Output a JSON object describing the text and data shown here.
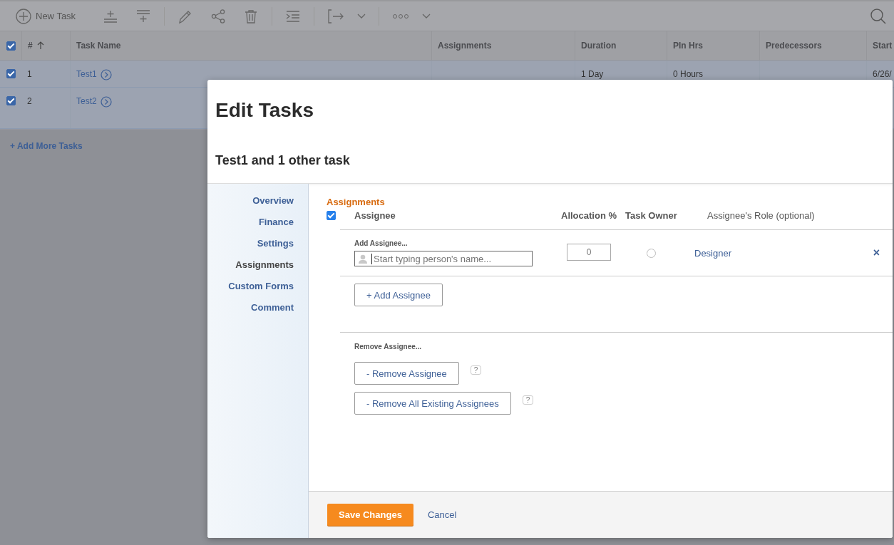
{
  "toolbar": {
    "new_task": "New Task"
  },
  "table": {
    "select_all_checked": true,
    "columns": [
      {
        "label": "#",
        "sort_ascending": true
      },
      {
        "label": "Task Name"
      },
      {
        "label": "Assignments"
      },
      {
        "label": "Duration"
      },
      {
        "label": "Pln Hrs"
      },
      {
        "label": "Predecessors"
      },
      {
        "label": "Start"
      }
    ],
    "rows": [
      {
        "checked": true,
        "cells": [
          "1",
          "Test1",
          "",
          "1 Day",
          "0 Hours",
          "",
          "6/26/"
        ]
      },
      {
        "checked": true,
        "cells": [
          "2",
          "Test2"
        ]
      }
    ],
    "add_more": "+ Add More Tasks"
  },
  "dialog": {
    "title": "Edit Tasks",
    "subtitle": "Test1 and 1 other task",
    "nav": [
      {
        "label": "Overview",
        "selected": false
      },
      {
        "label": "Finance",
        "selected": false
      },
      {
        "label": "Settings",
        "selected": false
      },
      {
        "label": "Assignments",
        "selected": true
      },
      {
        "label": "Custom Forms",
        "selected": false
      },
      {
        "label": "Comment",
        "selected": false
      }
    ],
    "section_title": "Assignments",
    "header_checked": true,
    "columns": [
      "Assignee",
      "Allocation %",
      "Task Owner",
      "Assignee's Role (optional)"
    ],
    "assignee_row": {
      "label": "Add Assignee...",
      "placeholder": "Start typing person's name...",
      "allocation_placeholder": "0",
      "task_owner": false,
      "role": "Designer",
      "remove": "×"
    },
    "add_button": "+ Add Assignee",
    "remove_label": "Remove Assignee...",
    "remove_buttons": [
      {
        "label": "- Remove Assignee",
        "help": "?"
      },
      {
        "label": "- Remove All Existing Assignees",
        "help": "?"
      }
    ],
    "footer": {
      "save": "Save Changes",
      "cancel": "Cancel"
    }
  }
}
